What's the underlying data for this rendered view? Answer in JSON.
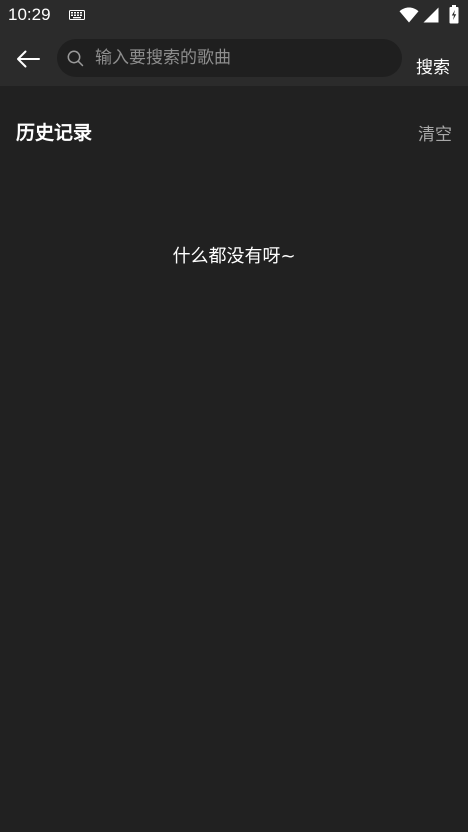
{
  "status_bar": {
    "time": "10:29",
    "icons": [
      "keyboard-icon",
      "wifi-icon",
      "signal-icon",
      "battery-icon"
    ]
  },
  "header": {
    "back_icon": "arrow-left-icon",
    "search_placeholder": "输入要搜索的歌曲",
    "search_value": "",
    "search_button_label": "搜索"
  },
  "history": {
    "title": "历史记录",
    "clear_label": "清空",
    "empty_message": "什么都没有呀~"
  },
  "colors": {
    "background": "#212121",
    "bar_background": "#2b2b2b",
    "search_box_background": "#1f1f1f",
    "text_primary": "#ffffff",
    "text_secondary": "#a8a8a8",
    "placeholder": "#8e8e8e"
  }
}
